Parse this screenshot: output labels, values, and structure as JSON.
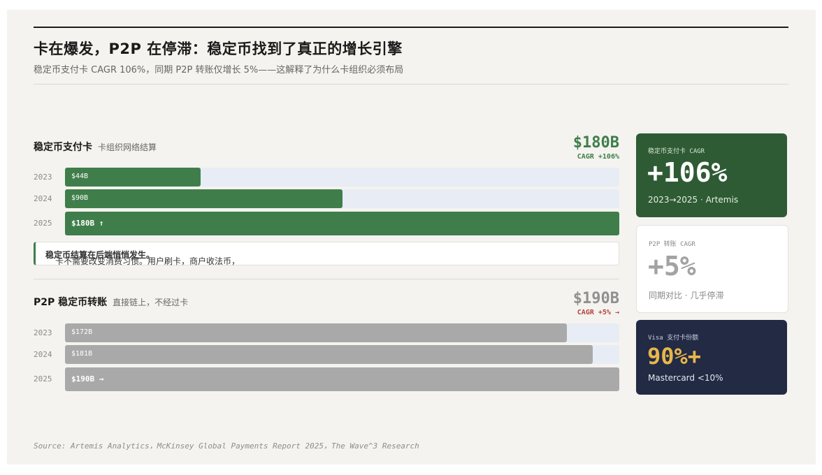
{
  "header": {
    "title": "卡在爆发，P2P 在停滞：稳定币找到了真正的增长引擎",
    "subtitle": "稳定币支付卡 CAGR 106%，同期 P2P 转账仅增长 5%——这解释了为什么卡组织必须布局"
  },
  "card_section": {
    "title": "稳定币支付卡",
    "note": "卡组织网络结算",
    "total": "$180B",
    "cagr": "CAGR +106%"
  },
  "p2p_section": {
    "title": "P2P 稳定币转账",
    "note": "直接链上，不经过卡",
    "total": "$190B",
    "cagr": "CAGR +5% →"
  },
  "callout": {
    "text": "卡不需要改变消费习惯。用户刷卡，商户收法币，",
    "emphasis": "稳定币结算在后端悄悄发生。"
  },
  "stats": {
    "card_cagr": {
      "label": "稳定币支付卡 CAGR",
      "value": "+106%",
      "note": "2023→2025 · Artemis"
    },
    "p2p_cagr": {
      "label": "P2P 转账 CAGR",
      "value": "+5%",
      "note": "同期对比 · 几乎停滞"
    },
    "visa_share": {
      "label": "Visa 支付卡份额",
      "value": "90%+",
      "note": "Mastercard <10%"
    }
  },
  "source": "Source: Artemis Analytics，McKinsey Global Payments Report 2025，The Wave^3 Research",
  "colors": {
    "green": "#3f7e4a",
    "grey_bar": "#a9a9a9",
    "track": "#e8ecf4",
    "navy": "#222a44",
    "gold": "#e8b64a",
    "red": "#b5433a"
  },
  "chart_data": [
    {
      "type": "bar",
      "orientation": "horizontal",
      "title": "稳定币支付卡",
      "categories": [
        "2023",
        "2024",
        "2025"
      ],
      "values": [
        44,
        90,
        180
      ],
      "unit": "$B",
      "xlim": [
        0,
        180
      ],
      "data_labels": [
        "$44B",
        "$90B",
        "$180B ↑"
      ]
    },
    {
      "type": "bar",
      "orientation": "horizontal",
      "title": "P2P 稳定币转账",
      "categories": [
        "2023",
        "2024",
        "2025"
      ],
      "values": [
        172,
        181,
        190
      ],
      "unit": "$B",
      "xlim": [
        0,
        190
      ],
      "data_labels": [
        "$172B",
        "$181B",
        "$190B →"
      ]
    }
  ]
}
